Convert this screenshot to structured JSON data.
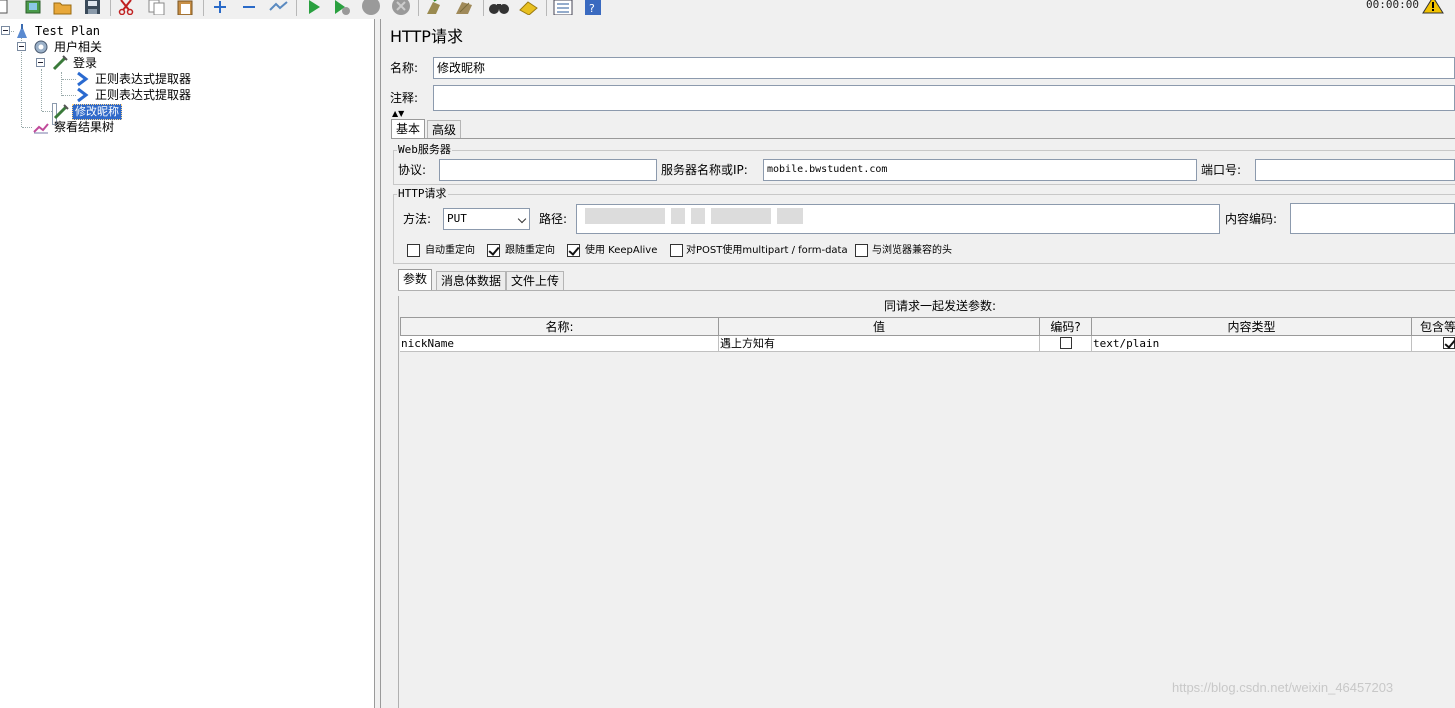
{
  "toolbar": {
    "timer": "00:00:00",
    "icons": [
      "new-icon",
      "templates-icon",
      "open-icon",
      "save-icon",
      "cut-icon",
      "copy-icon",
      "paste-icon",
      "expand-icon",
      "collapse-icon",
      "toggle-icon",
      "start-icon",
      "start-no-pause-icon",
      "stop-icon",
      "shutdown-icon",
      "clear-icon",
      "clear-all-icon",
      "search-icon",
      "reset-search-icon",
      "function-helper-icon",
      "help-icon",
      "warning-icon"
    ]
  },
  "tree": {
    "items": [
      {
        "label": "Test Plan",
        "icon": "test-plan-icon"
      },
      {
        "label": "用户相关",
        "icon": "thread-group-icon"
      },
      {
        "label": "登录",
        "icon": "sampler-icon"
      },
      {
        "label": "正则表达式提取器",
        "icon": "extractor-icon"
      },
      {
        "label": "正则表达式提取器",
        "icon": "extractor-icon"
      },
      {
        "label": "修改昵称",
        "icon": "sampler-icon",
        "selected": true
      },
      {
        "label": "察看结果树",
        "icon": "listener-icon"
      }
    ]
  },
  "panel": {
    "title": "HTTP请求",
    "name_label": "名称:",
    "name_value": "修改昵称",
    "comment_label": "注释:",
    "comment_value": "",
    "tabs": [
      "基本",
      "高级"
    ],
    "web_server": {
      "caption": "Web服务器",
      "protocol_label": "协议:",
      "protocol_value": "",
      "server_label": "服务器名称或IP:",
      "server_value": "mobile.bwstudent.com",
      "port_label": "端口号:",
      "port_value": ""
    },
    "http_request": {
      "caption": "HTTP请求",
      "method_label": "方法:",
      "method_value": "PUT",
      "path_label": "路径:",
      "encoding_label": "内容编码:",
      "encoding_value": "",
      "checkboxes": [
        {
          "label": "自动重定向",
          "checked": false
        },
        {
          "label": "跟随重定向",
          "checked": true
        },
        {
          "label": "使用 KeepAlive",
          "checked": true
        },
        {
          "label": "对POST使用multipart / form-data",
          "checked": false
        },
        {
          "label": "与浏览器兼容的头",
          "checked": false
        }
      ]
    },
    "sub_tabs": [
      "参数",
      "消息体数据",
      "文件上传"
    ],
    "params_caption": "同请求一起发送参数:",
    "table": {
      "headers": [
        "名称:",
        "值",
        "编码?",
        "内容类型",
        "包含等"
      ],
      "rows": [
        {
          "name": "nickName",
          "value": "遇上方知有",
          "encode": false,
          "content_type": "text/plain",
          "include_equals": true
        }
      ]
    }
  },
  "watermark": "https://blog.csdn.net/weixin_46457203"
}
